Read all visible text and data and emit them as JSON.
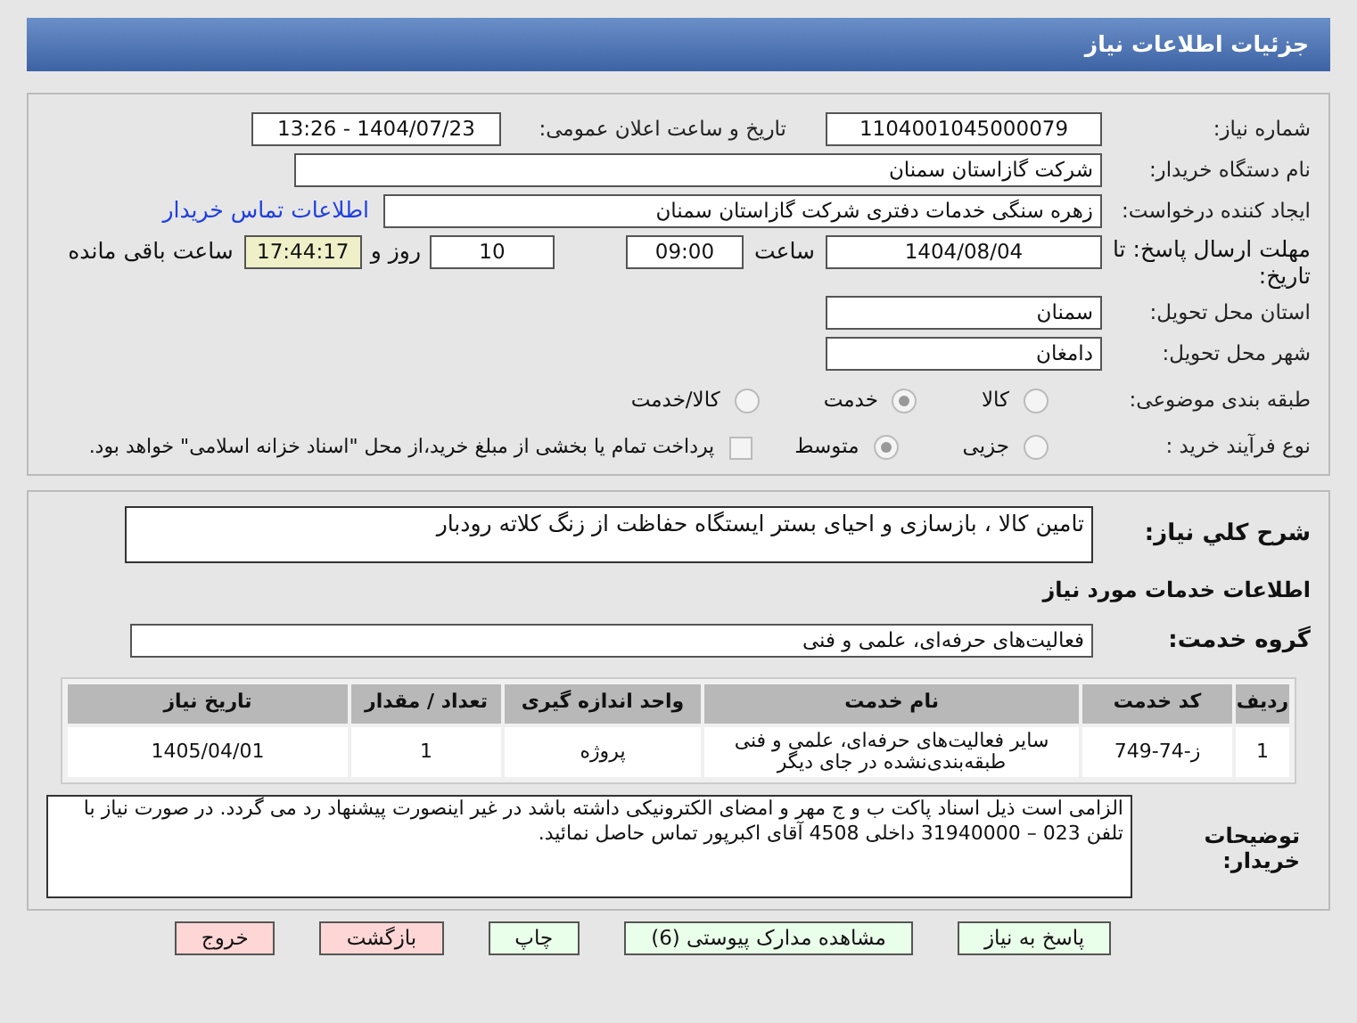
{
  "header": {
    "title": "جزئیات اطلاعات نیاز"
  },
  "need_number": {
    "label": "شماره نیاز:",
    "value": "1104001045000079"
  },
  "announce": {
    "label": "تاریخ و ساعت اعلان عمومی:",
    "value": "1404/07/23 - 13:26"
  },
  "buyer": {
    "label": "نام دستگاه خریدار:",
    "value": "شرکت گازاستان سمنان"
  },
  "creator": {
    "label": "ایجاد کننده درخواست:",
    "value": "زهره سنگی خدمات دفتری شرکت گازاستان سمنان",
    "link": "اطلاعات تماس خریدار"
  },
  "deadline": {
    "label": "مهلت ارسال پاسخ: تا تاریخ:",
    "date": "1404/08/04",
    "time_label": "ساعت",
    "time": "09:00",
    "days": "10",
    "days_label": "روز و",
    "remaining": "17:44:17",
    "remaining_label": "ساعت باقی مانده"
  },
  "province": {
    "label": "استان محل تحویل:",
    "value": "سمنان"
  },
  "city": {
    "label": "شهر محل تحویل:",
    "value": "دامغان"
  },
  "category": {
    "label": "طبقه بندی موضوعی:",
    "options": [
      {
        "label": "کالا",
        "selected": false
      },
      {
        "label": "خدمت",
        "selected": true
      },
      {
        "label": "کالا/خدمت",
        "selected": false
      }
    ]
  },
  "process": {
    "label": "نوع فرآیند خرید :",
    "options": [
      {
        "label": "جزیی",
        "selected": false
      },
      {
        "label": "متوسط",
        "selected": true
      }
    ],
    "payment": {
      "label": "پرداخت تمام یا بخشی از مبلغ خرید،از محل \"اسناد خزانه اسلامی\" خواهد بود.",
      "checked": false
    }
  },
  "summary": {
    "label": "شرح کلي نیاز:",
    "value": "تامین کالا ، بازسازی و احیای بستر ایستگاه حفاظت از زنگ کلاته رودبار"
  },
  "services_title": "اطلاعات خدمات مورد نیاز",
  "service_group": {
    "label": "گروه خدمت:",
    "value": "فعالیت‌های حرفه‌ای، علمی و فنی"
  },
  "table": {
    "columns": [
      "ردیف",
      "کد خدمت",
      "نام خدمت",
      "واحد اندازه گیری",
      "تعداد / مقدار",
      "تاریخ نیاز"
    ],
    "rows": [
      [
        "1",
        "ز-74-749",
        "سایر فعالیت‌های حرفه‌ای، علمی و فنی طبقه‌بندی‌نشده در جای دیگر",
        "پروژه",
        "1",
        "1405/04/01"
      ]
    ]
  },
  "notes": {
    "label": "توضیحات خریدار:",
    "value": "الزامی است ذیل اسناد پاکت ب و ج مهر و امضای الکترونیکی داشته باشد در غیر اینصورت پیشنهاد رد می گردد. در صورت نیاز با تلفن 023 – 31940000  داخلی 4508  آقای اکبرپور تماس حاصل نمائید."
  },
  "buttons": [
    {
      "label": "پاسخ به نیاز",
      "color": "#eaffea"
    },
    {
      "label": "مشاهده مدارک پیوستی (6)",
      "color": "#eaffea"
    },
    {
      "label": "چاپ",
      "color": "#eaffea"
    },
    {
      "label": "بازگشت",
      "color": "#ffd6d6"
    },
    {
      "label": "خروج",
      "color": "#ffd6d6"
    }
  ]
}
